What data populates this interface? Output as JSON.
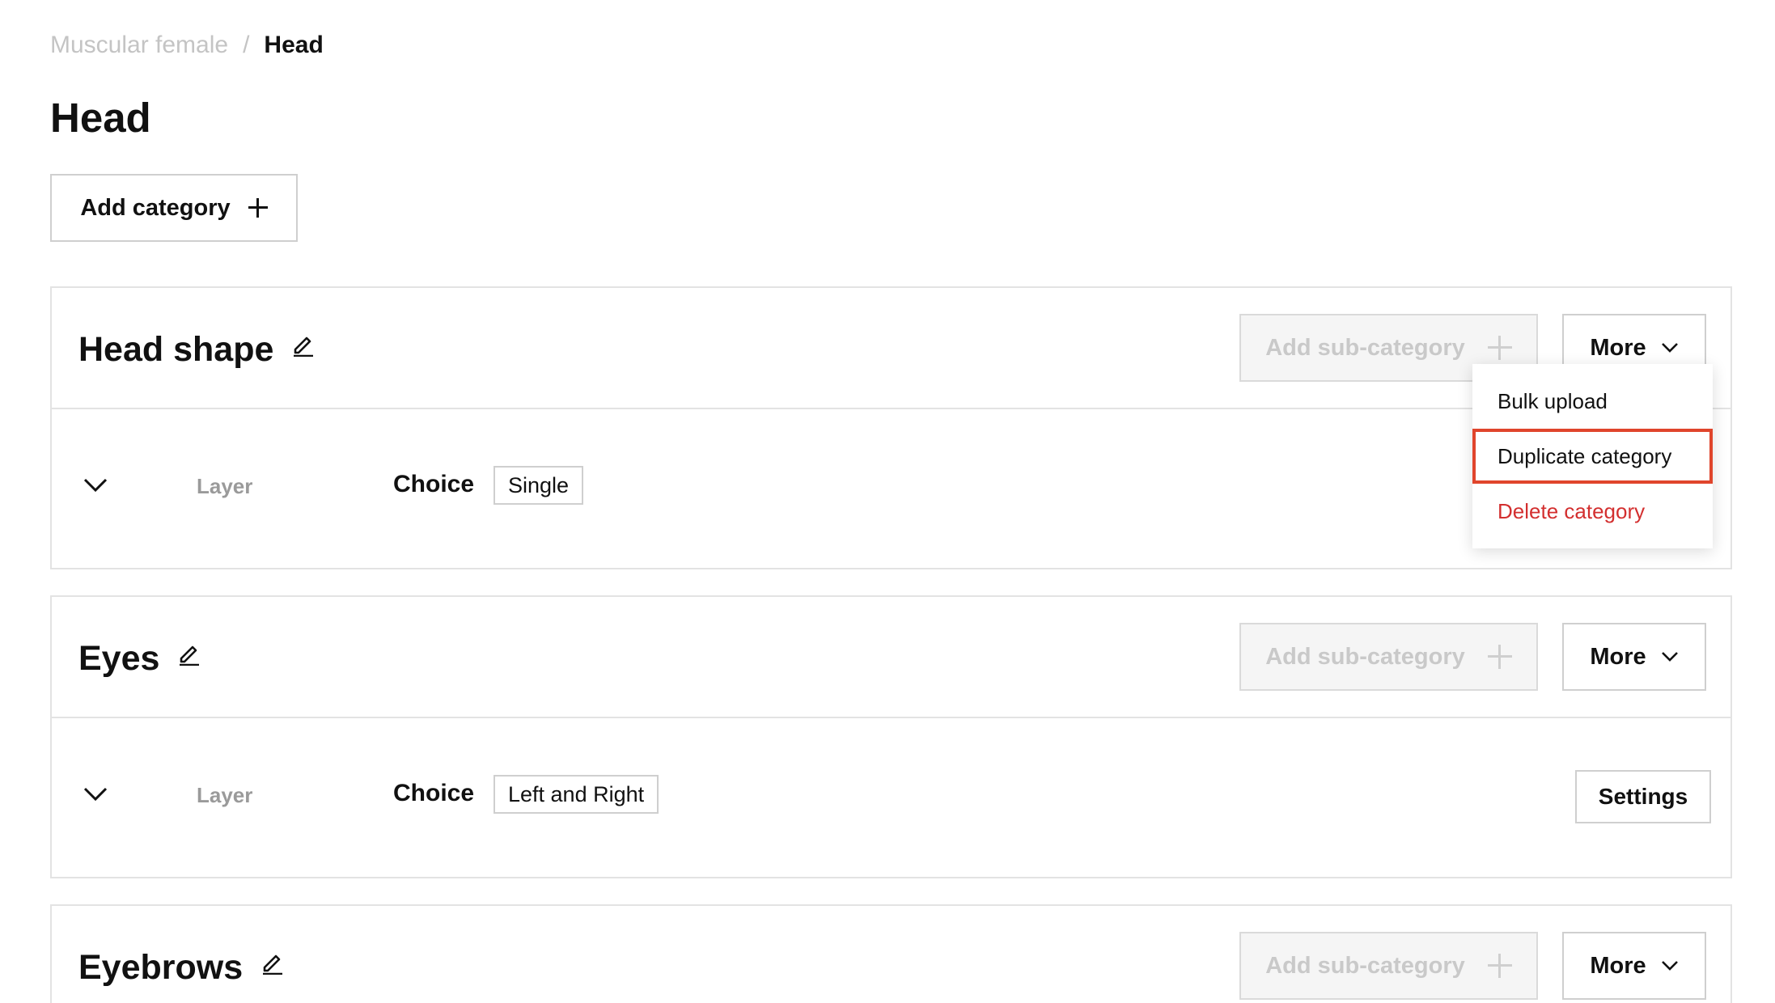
{
  "breadcrumb": {
    "parent": "Muscular female",
    "separator": "/",
    "current": "Head"
  },
  "page_title": "Head",
  "add_category_label": "Add category",
  "categories": [
    {
      "title": "Head shape",
      "add_sub_label": "Add sub-category",
      "more_label": "More",
      "row": {
        "layer_label": "Layer",
        "choice_label": "Choice",
        "choice_value": "Single"
      }
    },
    {
      "title": "Eyes",
      "add_sub_label": "Add sub-category",
      "more_label": "More",
      "row": {
        "layer_label": "Layer",
        "choice_label": "Choice",
        "choice_value": "Left and Right",
        "settings_label": "Settings"
      }
    },
    {
      "title": "Eyebrows",
      "add_sub_label": "Add sub-category",
      "more_label": "More"
    }
  ],
  "more_menu": {
    "items": [
      {
        "label": "Bulk upload"
      },
      {
        "label": "Duplicate category",
        "highlighted": true
      },
      {
        "label": "Delete category",
        "danger": true
      }
    ]
  },
  "colors": {
    "highlight": "#e0452c",
    "danger": "#d32f2f",
    "muted": "#c4c4c4"
  },
  "icons": {
    "edit": "pencil-icon",
    "add": "plus-icon",
    "more": "chevron-down-icon",
    "expand": "chevron-down-icon"
  }
}
